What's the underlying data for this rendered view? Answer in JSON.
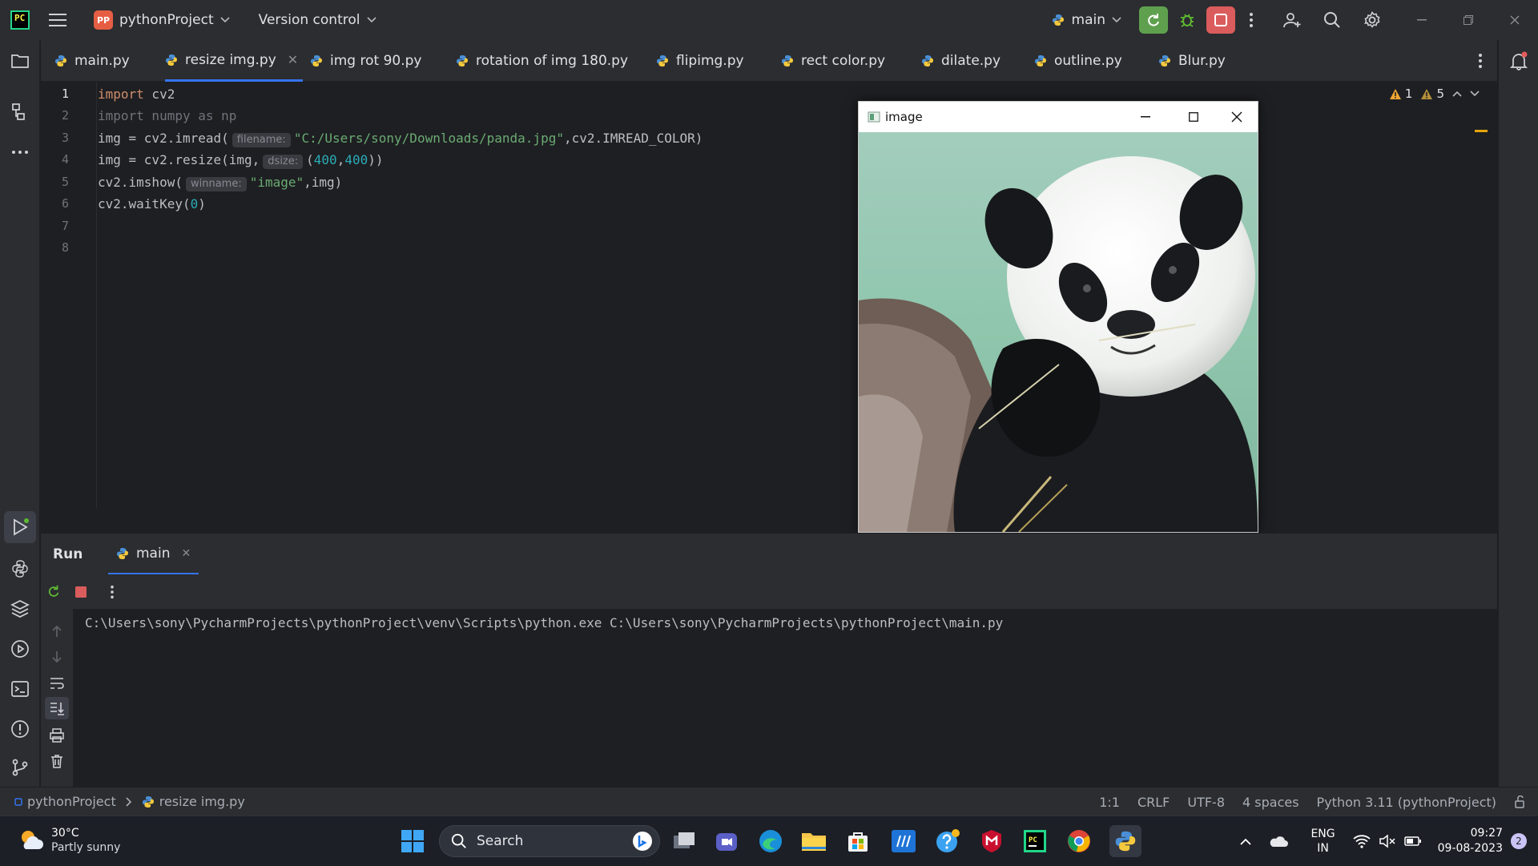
{
  "titlebar": {
    "logo_text": "PC",
    "project_badge": "PP",
    "project_name": "pythonProject",
    "vcs": "Version control",
    "run_config": "main"
  },
  "tabs": [
    {
      "label": "main.py"
    },
    {
      "label": "resize img.py",
      "active": true
    },
    {
      "label": "img rot 90.py"
    },
    {
      "label": "rotation of img 180.py"
    },
    {
      "label": "flipimg.py"
    },
    {
      "label": "rect color.py"
    },
    {
      "label": "dilate.py"
    },
    {
      "label": "outline.py"
    },
    {
      "label": "Blur.py"
    }
  ],
  "editor": {
    "line_numbers": [
      "1",
      "2",
      "3",
      "4",
      "5",
      "6",
      "7",
      "8"
    ],
    "warnings": {
      "count_a": "1",
      "count_b": "5"
    },
    "lines": {
      "l1_kw": "import",
      "l1_rest": " cv2",
      "l2": "import numpy as np",
      "l3_a": "img = cv2.imread(",
      "l3_hint": "filename:",
      "l3_str": "\"C:/Users/sony/Downloads/panda.jpg\"",
      "l3_b": ",cv2.IMREAD_COLOR)",
      "l4_a": "img = cv2.resize(img,",
      "l4_hint": "dsize:",
      "l4_b": "(",
      "l4_n1": "400",
      "l4_c": ",",
      "l4_n2": "400",
      "l4_d": "))",
      "l5_a": "cv2.imshow(",
      "l5_hint": "winname:",
      "l5_str": "\"image\"",
      "l5_b": ",img)",
      "l6_a": "cv2.waitKey(",
      "l6_n": "0",
      "l6_b": ")"
    }
  },
  "image_window": {
    "title": "image"
  },
  "run_panel": {
    "title": "Run",
    "tab": "main",
    "console_output": "C:\\Users\\sony\\PycharmProjects\\pythonProject\\venv\\Scripts\\python.exe C:\\Users\\sony\\PycharmProjects\\pythonProject\\main.py"
  },
  "statusbar": {
    "breadcrumb_project": "pythonProject",
    "breadcrumb_file": "resize img.py",
    "position": "1:1",
    "line_sep": "CRLF",
    "encoding": "UTF-8",
    "indent": "4 spaces",
    "interpreter": "Python 3.11 (pythonProject)"
  },
  "taskbar": {
    "weather_temp": "30°C",
    "weather_desc": "Partly sunny",
    "search_placeholder": "Search",
    "lang_top": "ENG",
    "lang_bottom": "IN",
    "time": "09:27",
    "date": "09-08-2023",
    "notification_count": "2"
  },
  "colors": {
    "accent": "#3574f0",
    "run_green": "#5fa04e",
    "stop_red": "#db5c5c"
  }
}
